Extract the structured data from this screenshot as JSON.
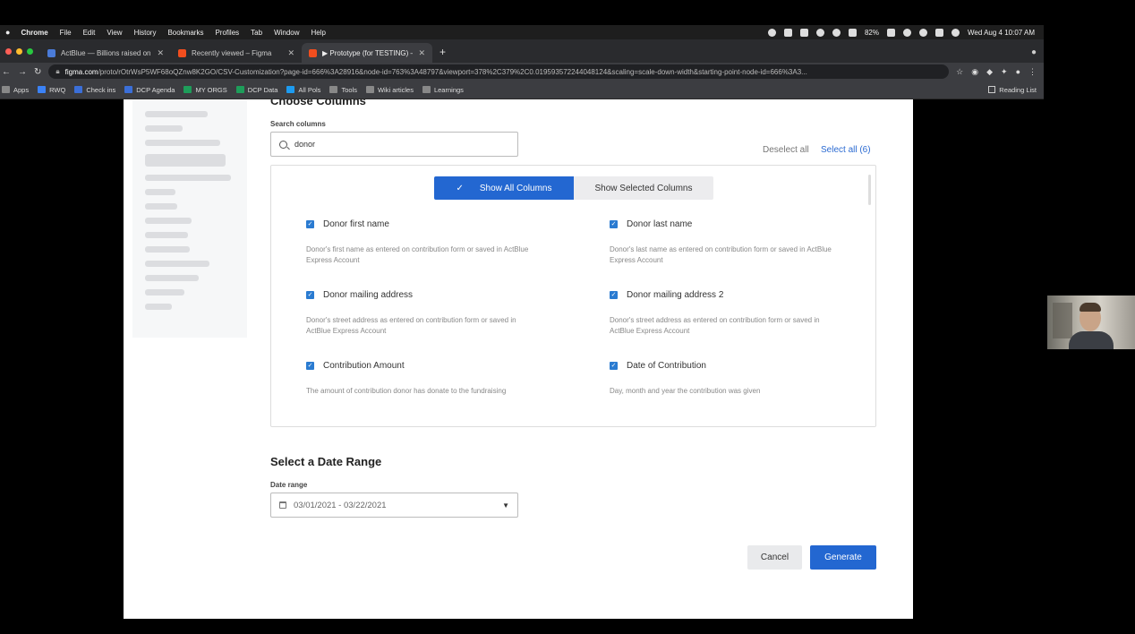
{
  "menubar": {
    "items": [
      "Chrome",
      "File",
      "Edit",
      "View",
      "History",
      "Bookmarks",
      "Profiles",
      "Tab",
      "Window",
      "Help"
    ],
    "battery": "82%",
    "datetime": "Wed Aug 4  10:07 AM"
  },
  "tabs": [
    {
      "title": "ActBlue — Billions raised online",
      "icon": "actblue-favicon"
    },
    {
      "title": "Recently viewed – Figma",
      "icon": "figma-favicon"
    },
    {
      "title": "▶ Prototype (for TESTING) – C",
      "icon": "figma-favicon"
    }
  ],
  "address": {
    "host": "figma.com",
    "path": "/proto/rOtrWsP5WF68oQZnw8K2GO/CSV-Customization?page-id=666%3A28916&node-id=763%3A48797&viewport=378%2C379%2C0.019593572244048124&scaling=scale-down-width&starting-point-node-id=666%3A3..."
  },
  "bookmarks": [
    "Apps",
    "RWQ",
    "Check ins",
    "DCP Agenda",
    "MY ORGS",
    "DCP Data",
    "All Pols",
    "Tools",
    "Wiki articles",
    "Learnings"
  ],
  "reading_list": "Reading List",
  "choose_columns": {
    "title": "Choose Columns",
    "search_label": "Search columns",
    "search_value": "donor",
    "deselect_all": "Deselect all",
    "select_all": "Select all (6)",
    "toggle_on": "Show All Columns",
    "toggle_off": "Show Selected Columns",
    "columns": [
      {
        "name": "Donor first name",
        "desc": "Donor's first name as entered on contribution form or saved in ActBlue Express Account"
      },
      {
        "name": "Donor last name",
        "desc": "Donor's last name as entered on contribution form or saved in ActBlue Express Account"
      },
      {
        "name": "Donor mailing address",
        "desc": "Donor's street address as entered on contribution form or saved in ActBlue Express Account"
      },
      {
        "name": "Donor mailing address 2",
        "desc": "Donor's street address as entered on contribution form or saved in ActBlue Express Account"
      },
      {
        "name": "Contribution Amount",
        "desc": "The amount of contribution donor has donate to the fundraising"
      },
      {
        "name": "Date of Contribution",
        "desc": "Day, month and year the contribution was given"
      }
    ]
  },
  "date_range": {
    "title": "Select a Date Range",
    "label": "Date range",
    "value": "03/01/2021 - 03/22/2021"
  },
  "actions": {
    "cancel": "Cancel",
    "generate": "Generate"
  },
  "colors": {
    "primary": "#2367d1",
    "checkbox": "#2a7bd1"
  }
}
